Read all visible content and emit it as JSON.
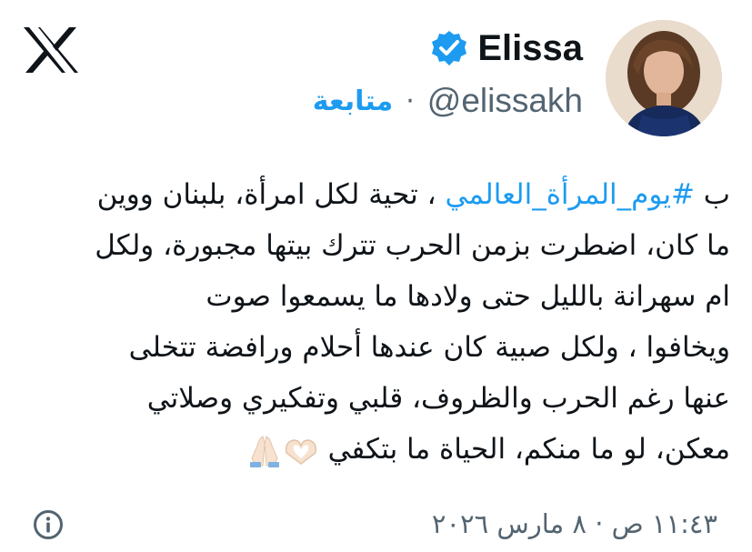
{
  "user": {
    "display_name": "Elissa",
    "handle": "@elissakh",
    "follow_label": "متابعة",
    "separator": "·"
  },
  "tweet": {
    "lines": [
      {
        "pre": "ب ",
        "hashtag": "#يوم_المرأة_العالمي",
        "post": " ، تحية لكل امرأة، بلبنان ووين"
      },
      {
        "text": "ما كان، اضطرت بزمن الحرب تترك بيتها مجبورة، ولكل"
      },
      {
        "text": "ام سهرانة بالليل حتى ولادها ما يسمعوا صوت"
      },
      {
        "text": "ويخافوا ، ولكل صبية كان عندها أحلام ورافضة تتخلى"
      },
      {
        "text": "عنها رغم الحرب والظروف، قلبي وتفكيري وصلاتي"
      },
      {
        "text": "معكن، لو ما منكم، الحياة ما بتكفي"
      }
    ],
    "emojis": [
      "heart-hands-emoji",
      "folded-hands-emoji"
    ]
  },
  "meta": {
    "timestamp": "١١:٤٣ ص · ٨ مارس ٢٠٢٦"
  },
  "icons": {
    "logo": "x-logo-icon",
    "verified": "verified-badge-icon",
    "info": "info-icon"
  },
  "colors": {
    "text": "#0f1419",
    "secondary": "#536471",
    "accent": "#1d9bf0"
  }
}
